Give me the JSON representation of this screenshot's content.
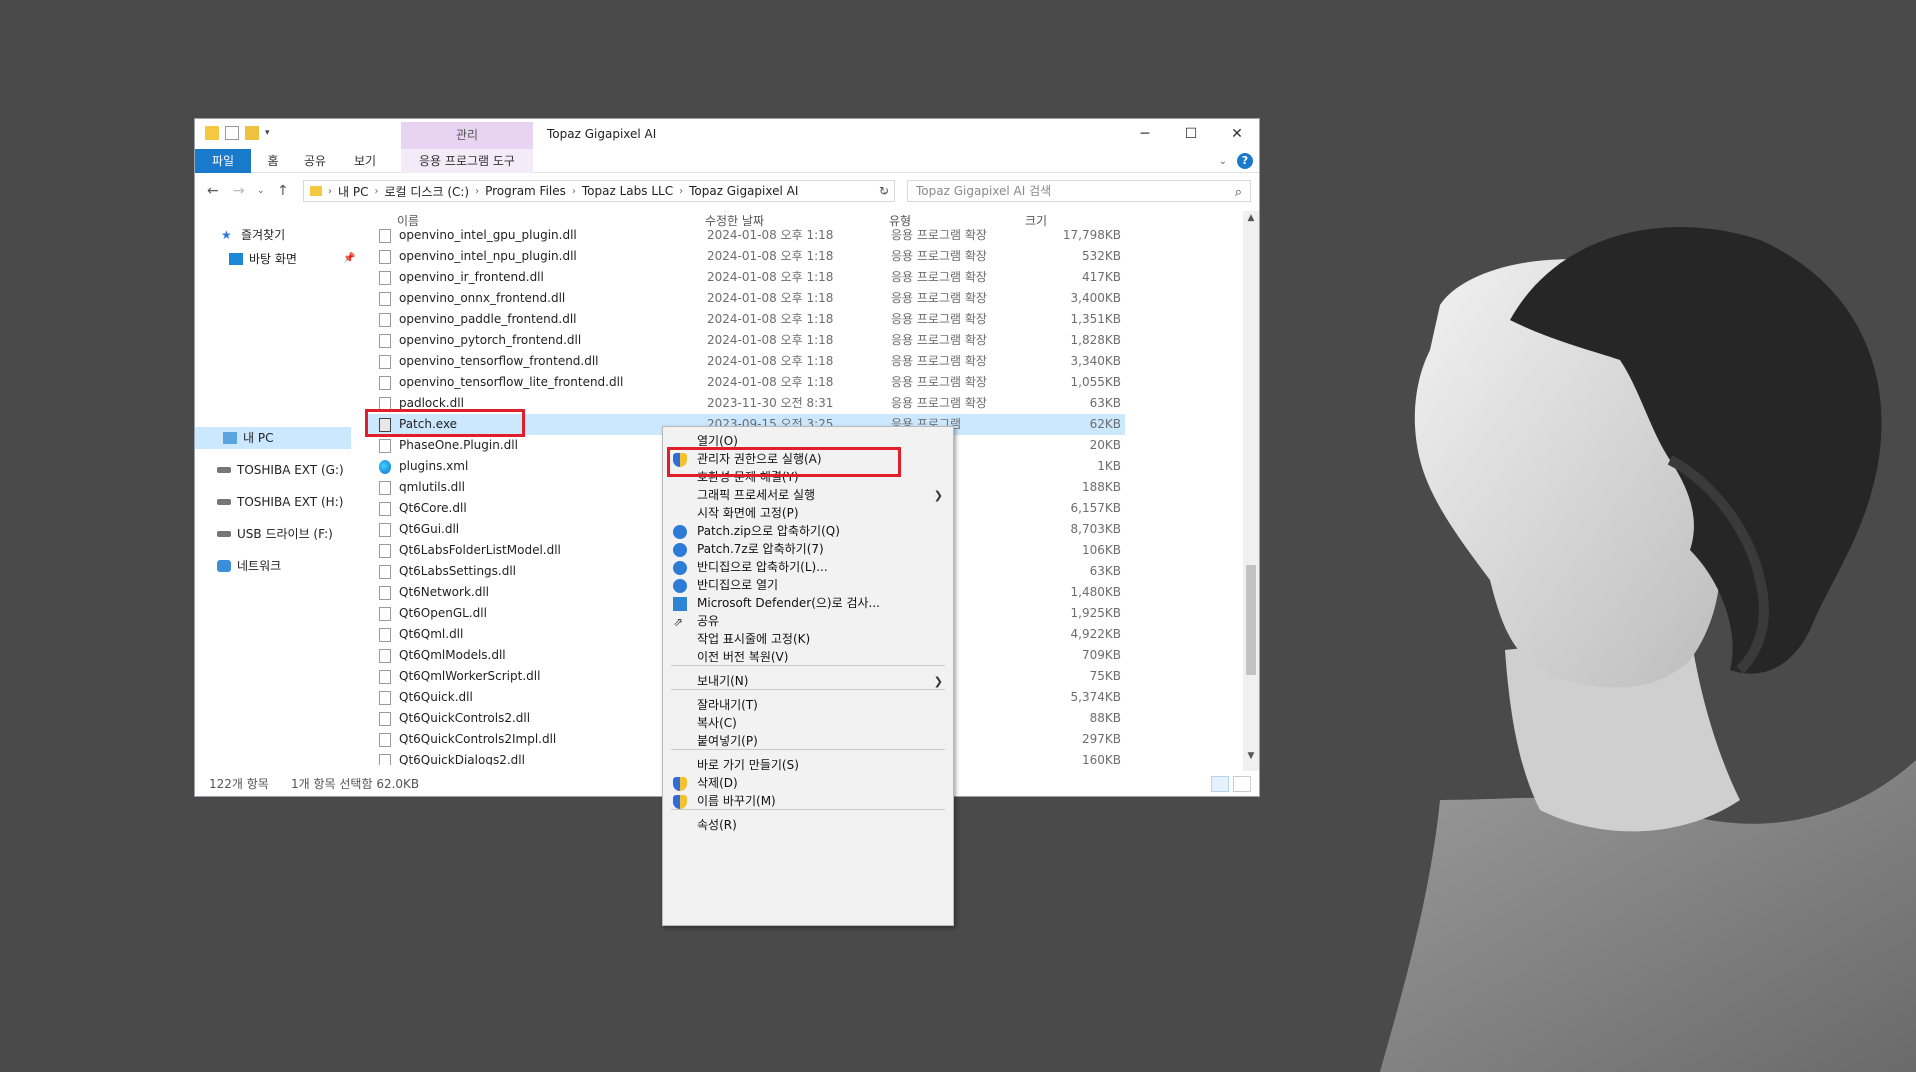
{
  "window": {
    "title": "Topaz Gigapixel AI",
    "manage_tab": "관리",
    "controls": {
      "minimize": "─",
      "maximize": "☐",
      "close": "✕"
    }
  },
  "ribbon": {
    "tabs": [
      "파일",
      "홈",
      "공유",
      "보기",
      "응용 프로그램 도구"
    ]
  },
  "address": {
    "crumbs": [
      "내 PC",
      "로컬 디스크 (C:)",
      "Program Files",
      "Topaz Labs LLC",
      "Topaz Gigapixel AI"
    ],
    "search_placeholder": "Topaz Gigapixel AI 검색"
  },
  "sidebar": {
    "items": [
      "즐겨찾기",
      "바탕 화면",
      "내 PC",
      "TOSHIBA EXT (G:)",
      "TOSHIBA EXT (H:)",
      "USB 드라이브 (F:)",
      "네트워크"
    ]
  },
  "columns": {
    "name": "이름",
    "date": "수정한 날짜",
    "type": "유형",
    "size": "크기"
  },
  "files": [
    {
      "name": "openvino_intel_gpu_plugin.dll",
      "date": "2024-01-08 오후 1:18",
      "type": "응용 프로그램 확장",
      "size": "17,798KB"
    },
    {
      "name": "openvino_intel_npu_plugin.dll",
      "date": "2024-01-08 오후 1:18",
      "type": "응용 프로그램 확장",
      "size": "532KB"
    },
    {
      "name": "openvino_ir_frontend.dll",
      "date": "2024-01-08 오후 1:18",
      "type": "응용 프로그램 확장",
      "size": "417KB"
    },
    {
      "name": "openvino_onnx_frontend.dll",
      "date": "2024-01-08 오후 1:18",
      "type": "응용 프로그램 확장",
      "size": "3,400KB"
    },
    {
      "name": "openvino_paddle_frontend.dll",
      "date": "2024-01-08 오후 1:18",
      "type": "응용 프로그램 확장",
      "size": "1,351KB"
    },
    {
      "name": "openvino_pytorch_frontend.dll",
      "date": "2024-01-08 오후 1:18",
      "type": "응용 프로그램 확장",
      "size": "1,828KB"
    },
    {
      "name": "openvino_tensorflow_frontend.dll",
      "date": "2024-01-08 오후 1:18",
      "type": "응용 프로그램 확장",
      "size": "3,340KB"
    },
    {
      "name": "openvino_tensorflow_lite_frontend.dll",
      "date": "2024-01-08 오후 1:18",
      "type": "응용 프로그램 확장",
      "size": "1,055KB"
    },
    {
      "name": "padlock.dll",
      "date": "2023-11-30 오전 8:31",
      "type": "응용 프로그램 확장",
      "size": "63KB"
    },
    {
      "name": "Patch.exe",
      "date": "2023-09-15 오전 3:25",
      "type": "응용 프로그램",
      "size": "62KB"
    },
    {
      "name": "PhaseOne.Plugin.dll",
      "date": "",
      "type": "확장",
      "size": "20KB"
    },
    {
      "name": "plugins.xml",
      "date": "",
      "type": "e HTML ...",
      "size": "1KB"
    },
    {
      "name": "qmlutils.dll",
      "date": "",
      "type": "확장",
      "size": "188KB"
    },
    {
      "name": "Qt6Core.dll",
      "date": "",
      "type": "확장",
      "size": "6,157KB"
    },
    {
      "name": "Qt6Gui.dll",
      "date": "",
      "type": "확장",
      "size": "8,703KB"
    },
    {
      "name": "Qt6LabsFolderListModel.dll",
      "date": "",
      "type": "확장",
      "size": "106KB"
    },
    {
      "name": "Qt6LabsSettings.dll",
      "date": "",
      "type": "확장",
      "size": "63KB"
    },
    {
      "name": "Qt6Network.dll",
      "date": "",
      "type": "확장",
      "size": "1,480KB"
    },
    {
      "name": "Qt6OpenGL.dll",
      "date": "",
      "type": "확장",
      "size": "1,925KB"
    },
    {
      "name": "Qt6Qml.dll",
      "date": "",
      "type": "확장",
      "size": "4,922KB"
    },
    {
      "name": "Qt6QmlModels.dll",
      "date": "",
      "type": "확장",
      "size": "709KB"
    },
    {
      "name": "Qt6QmlWorkerScript.dll",
      "date": "",
      "type": "확장",
      "size": "75KB"
    },
    {
      "name": "Qt6Quick.dll",
      "date": "",
      "type": "확장",
      "size": "5,374KB"
    },
    {
      "name": "Qt6QuickControls2.dll",
      "date": "",
      "type": "확장",
      "size": "88KB"
    },
    {
      "name": "Qt6QuickControls2Impl.dll",
      "date": "",
      "type": "확장",
      "size": "297KB"
    },
    {
      "name": "Qt6QuickDialogs2.dll",
      "date": "",
      "type": "확장",
      "size": "160KB"
    }
  ],
  "status": {
    "count": "122개 항목",
    "selection": "1개 항목 선택함 62.0KB"
  },
  "context_menu": {
    "items": [
      "열기(O)",
      "관리자 권한으로 실행(A)",
      "호환성 문제 해결(Y)",
      "그래픽 프로세서로 실행",
      "시작 화면에 고정(P)",
      "Patch.zip으로 압축하기(Q)",
      "Patch.7z로 압축하기(7)",
      "반디집으로 압축하기(L)...",
      "반디집으로 열기",
      "Microsoft Defender(으)로 검사...",
      "공유",
      "작업 표시줄에 고정(K)",
      "이전 버전 복원(V)",
      "보내기(N)",
      "잘라내기(T)",
      "복사(C)",
      "붙여넣기(P)",
      "바로 가기 만들기(S)",
      "삭제(D)",
      "이름 바꾸기(M)",
      "속성(R)"
    ],
    "submenu_arrow": "❯"
  },
  "colors": {
    "highlight": "#e01f2a",
    "selection": "#cce8ff",
    "file_tab": "#1979ca",
    "manage_tab": "#e8d3f3"
  }
}
